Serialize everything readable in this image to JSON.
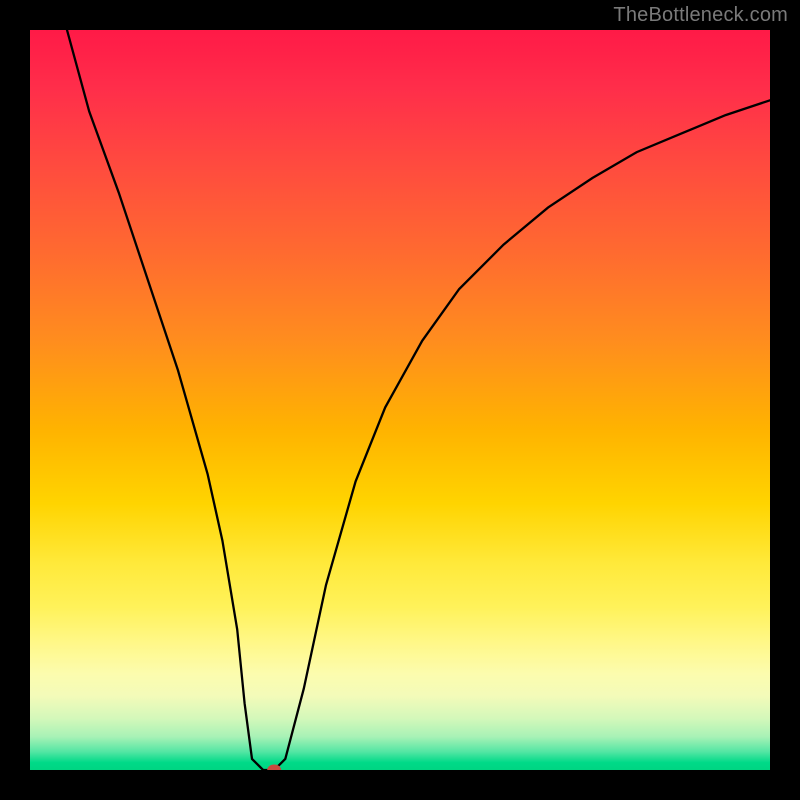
{
  "watermark": {
    "text": "TheBottleneck.com"
  },
  "chart_data": {
    "type": "line",
    "title": "",
    "xlabel": "",
    "ylabel": "",
    "xlim": [
      0,
      100
    ],
    "ylim": [
      0,
      100
    ],
    "grid": false,
    "legend": false,
    "series": [
      {
        "name": "curve",
        "x": [
          5,
          8,
          12,
          16,
          20,
          24,
          26,
          28,
          29,
          30,
          31.5,
          33,
          34.5,
          37,
          40,
          44,
          48,
          53,
          58,
          64,
          70,
          76,
          82,
          88,
          94,
          100
        ],
        "values": [
          100,
          89,
          78,
          66,
          54,
          40,
          31,
          19,
          9,
          1.5,
          0,
          0,
          1.5,
          11,
          25,
          39,
          49,
          58,
          65,
          71,
          76,
          80,
          83.5,
          86,
          88.5,
          90.5
        ]
      }
    ],
    "marker": {
      "x": 33,
      "y": 0,
      "color": "#c94a3f"
    },
    "background_gradient": {
      "top": "#ff1a47",
      "mid": "#ffd400",
      "bottom": "#00d582"
    }
  }
}
